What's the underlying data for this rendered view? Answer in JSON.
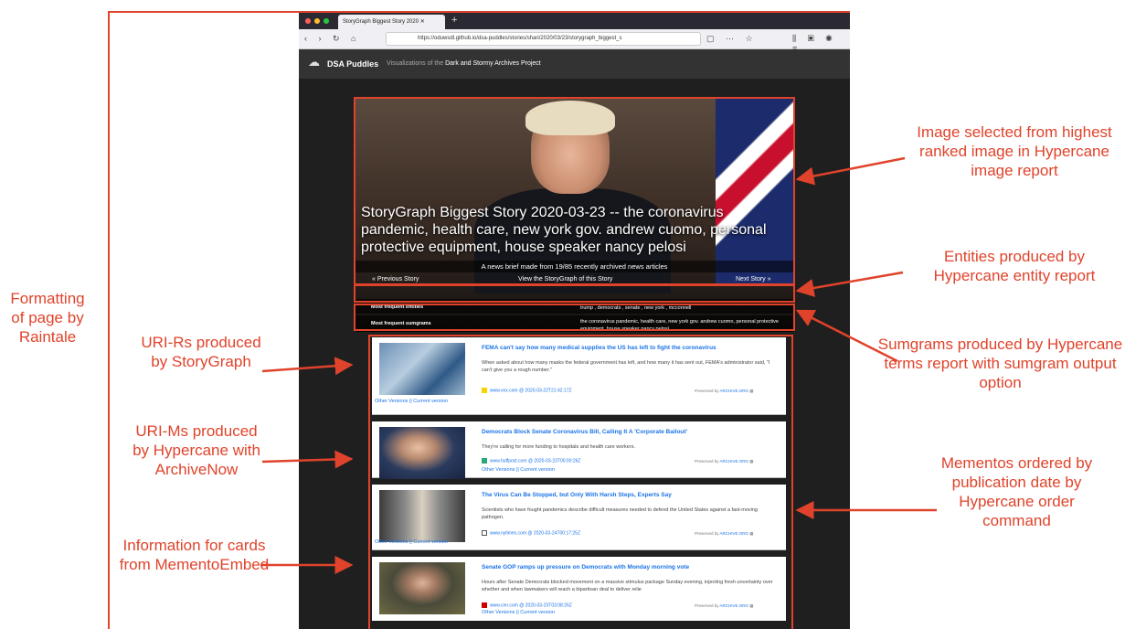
{
  "browser": {
    "tab_title": "StoryGraph Biggest Story 2020 ",
    "url": "https://oduwsdl.github.io/dsa-puddles/stories/shari/2020/03/23/storygraph_biggest_s"
  },
  "site": {
    "brand": "DSA Puddles",
    "subtitle_prefix": "Visualizations of the",
    "subtitle_highlight": "Dark and Stormy Archives Project"
  },
  "hero": {
    "title": "StoryGraph Biggest Story 2020-03-23 -- the coronavirus pandemic, health care, new york gov. andrew cuomo, personal protective equipment, house speaker nancy pelosi",
    "brief": "A news brief made from 19/85 recently archived news articles",
    "prev": "« Previous Story",
    "view": "View the StoryGraph of this Story",
    "next": "Next Story »",
    "entities_label": "Most frequent entities",
    "entities_value": "trump , democrats , senate , new york , mcconnell",
    "sumgrams_label": "Most frequent sumgrams",
    "sumgrams_value": "the coronavirus pandemic, health care, new york gov. andrew cuomo, personal protective equipment, house speaker nancy pelosi"
  },
  "cards": [
    {
      "title": "FEMA can't say how many medical supplies the US has left to fight the coronavirus",
      "snippet": "When asked about how many masks the federal government has left, and how many it has sent out, FEMA's administrator said, \"I can't give you a rough number.\"",
      "meta": "www.vox.com  @  2020-03-22T21:42:17Z",
      "preserved": "Preserved by",
      "archive": "ARCHIVE.ORG",
      "links": "Other Versions  || Current version"
    },
    {
      "title": "Democrats Block Senate Coronavirus Bill, Calling It A 'Corporate Bailout'",
      "snippet": "They're calling for more funding to hospitals and health care workers.",
      "meta": "www.huffpost.com  @  2020-03-23T00:00:26Z",
      "preserved": "Preserved by",
      "archive": "ARCHIVE.ORG",
      "links": "Other Versions  || Current version"
    },
    {
      "title": "The Virus Can Be Stopped, but Only With Harsh Steps, Experts Say",
      "snippet": "Scientists who have fought pandemics describe difficult measures needed to defend the United States against a fast-moving pathogen.",
      "meta": "www.nytimes.com  @  2020-03-24T00:17:25Z",
      "preserved": "Preserved by",
      "archive": "ARCHIVE.ORG",
      "links": "Other Versions  || Current version"
    },
    {
      "title": "Senate GOP ramps up pressure on Democrats with Monday morning vote",
      "snippet": "Hours after Senate Democrats blocked movement on a massive stimulus package Sunday evening, injecting fresh uncertainty over whether and when lawmakers will reach a bipartisan deal to deliver relie",
      "meta": "www.cnn.com  @  2020-03-23T03:08:26Z",
      "preserved": "Preserved by",
      "archive": "ARCHIVE.ORG",
      "links": "Other Versions  || Current version"
    }
  ],
  "annotations": {
    "formatting": "Formatting of page by Raintale",
    "urirs": "URI-Rs produced by StoryGraph",
    "urims": "URI-Ms produced by Hypercane with ArchiveNow",
    "info_cards": "Information for cards from MementoEmbed",
    "image_selected": "Image selected from highest ranked image in Hypercane image report",
    "entities": "Entities produced by Hypercane entity report",
    "sumgrams": "Sumgrams produced by Hypercane terms report with sumgram output option",
    "mementos": "Mementos ordered by publication date by Hypercane order command"
  },
  "colors": {
    "accent": "#e0432b",
    "link": "#1a73e8"
  }
}
